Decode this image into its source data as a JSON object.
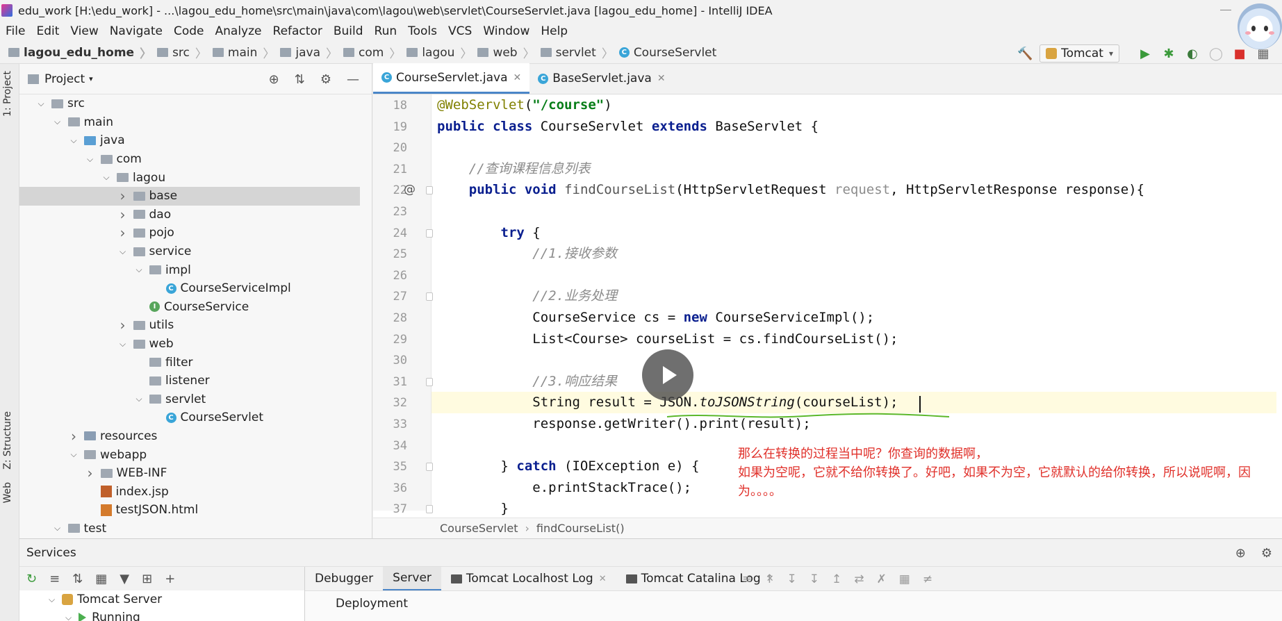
{
  "window": {
    "title": "edu_work [H:\\edu_work] - ...\\lagou_edu_home\\src\\main\\java\\com\\lagou\\web\\servlet\\CourseServlet.java [lagou_edu_home] - IntelliJ IDEA"
  },
  "menu": [
    "File",
    "Edit",
    "View",
    "Navigate",
    "Code",
    "Analyze",
    "Refactor",
    "Build",
    "Run",
    "Tools",
    "VCS",
    "Window",
    "Help"
  ],
  "breadcrumbs": [
    "lagou_edu_home",
    "src",
    "main",
    "java",
    "com",
    "lagou",
    "web",
    "servlet",
    "CourseServlet"
  ],
  "run_config": "Tomcat",
  "left_strip": {
    "project_tab": "1: Project",
    "structure_tab": "Z: Structure",
    "web_tab": "Web"
  },
  "project_panel": {
    "title": "Project",
    "tree": [
      {
        "label": "src",
        "depth": 0,
        "arrow": "v",
        "icon": "folder"
      },
      {
        "label": "main",
        "depth": 1,
        "arrow": "v",
        "icon": "folder"
      },
      {
        "label": "java",
        "depth": 2,
        "arrow": "v",
        "icon": "src-folder"
      },
      {
        "label": "com",
        "depth": 3,
        "arrow": "v",
        "icon": "folder"
      },
      {
        "label": "lagou",
        "depth": 4,
        "arrow": "v",
        "icon": "folder"
      },
      {
        "label": "base",
        "depth": 5,
        "arrow": ">",
        "icon": "folder",
        "selected": true
      },
      {
        "label": "dao",
        "depth": 5,
        "arrow": ">",
        "icon": "folder"
      },
      {
        "label": "pojo",
        "depth": 5,
        "arrow": ">",
        "icon": "folder"
      },
      {
        "label": "service",
        "depth": 5,
        "arrow": "v",
        "icon": "folder"
      },
      {
        "label": "impl",
        "depth": 6,
        "arrow": "v",
        "icon": "folder"
      },
      {
        "label": "CourseServiceImpl",
        "depth": 7,
        "arrow": "",
        "icon": "class"
      },
      {
        "label": "CourseService",
        "depth": 6,
        "arrow": "",
        "icon": "interface"
      },
      {
        "label": "utils",
        "depth": 5,
        "arrow": ">",
        "icon": "folder"
      },
      {
        "label": "web",
        "depth": 5,
        "arrow": "v",
        "icon": "folder"
      },
      {
        "label": "filter",
        "depth": 6,
        "arrow": "",
        "icon": "folder"
      },
      {
        "label": "listener",
        "depth": 6,
        "arrow": "",
        "icon": "folder"
      },
      {
        "label": "servlet",
        "depth": 6,
        "arrow": "v",
        "icon": "folder"
      },
      {
        "label": "CourseServlet",
        "depth": 7,
        "arrow": "",
        "icon": "class"
      },
      {
        "label": "resources",
        "depth": 2,
        "arrow": ">",
        "icon": "res-folder"
      },
      {
        "label": "webapp",
        "depth": 2,
        "arrow": "v",
        "icon": "folder"
      },
      {
        "label": "WEB-INF",
        "depth": 3,
        "arrow": ">",
        "icon": "folder"
      },
      {
        "label": "index.jsp",
        "depth": 3,
        "arrow": "",
        "icon": "jsp"
      },
      {
        "label": "testJSON.html",
        "depth": 3,
        "arrow": "",
        "icon": "html"
      },
      {
        "label": "test",
        "depth": 1,
        "arrow": "v",
        "icon": "folder"
      }
    ]
  },
  "editor": {
    "tabs": [
      {
        "label": "CourseServlet.java",
        "active": true
      },
      {
        "label": "BaseServlet.java",
        "active": false
      }
    ],
    "lines": [
      {
        "no": "18",
        "html": "<span class=\"ann\">@WebServlet</span>(<span class=\"str\">\"/course\"</span>)"
      },
      {
        "no": "19",
        "html": "<span class=\"kw\">public class</span> CourseServlet <span class=\"kw\">extends</span> BaseServlet {"
      },
      {
        "no": "20",
        "html": ""
      },
      {
        "no": "21",
        "html": "    <span class=\"cmt\">//查询课程信息列表</span>"
      },
      {
        "no": "22",
        "html": "    <span class=\"kw\">public void</span> <span class=\"fn\">findCourseList</span>(HttpServletRequest <span class=\"param\">request</span>, HttpServletResponse response){",
        "gutter": "@"
      },
      {
        "no": "23",
        "html": ""
      },
      {
        "no": "24",
        "html": "        <span class=\"kw\">try</span> {"
      },
      {
        "no": "25",
        "html": "            <span class=\"cmt\">//1.接收参数</span>"
      },
      {
        "no": "26",
        "html": ""
      },
      {
        "no": "27",
        "html": "            <span class=\"cmt\">//2.业务处理</span>"
      },
      {
        "no": "28",
        "html": "            CourseService cs = <span class=\"kw\">new</span> CourseServiceImpl();"
      },
      {
        "no": "29",
        "html": "            List&lt;Course&gt; courseList = cs.findCourseList();"
      },
      {
        "no": "30",
        "html": ""
      },
      {
        "no": "31",
        "html": "            <span class=\"cmt\">//3.响应结果</span>"
      },
      {
        "no": "32",
        "html": "            String result = JSON.<span class=\"itl\">toJSONString</span>(courseList);",
        "current": true
      },
      {
        "no": "33",
        "html": "            response.getWriter().print(result);"
      },
      {
        "no": "34",
        "html": ""
      },
      {
        "no": "35",
        "html": "        } <span class=\"kw\">catch</span> (IOException e) {"
      },
      {
        "no": "36",
        "html": "            e.printStackTrace();"
      },
      {
        "no": "37",
        "html": "        }"
      }
    ],
    "crumbs": [
      "CourseServlet",
      "findCourseList()"
    ]
  },
  "subtitle": {
    "line1": "那么在转换的过程当中呢？你查询的数据啊，",
    "line2": "如果为空呢，它就不给你转换了。好吧，如果不为空，它就默认的给你转换，所以说呢啊，因为。。。。"
  },
  "services": {
    "title": "Services",
    "tree": [
      {
        "label": "Tomcat Server",
        "arrow": "v"
      },
      {
        "label": "Running",
        "arrow": "v"
      }
    ],
    "tabs": [
      {
        "label": "Debugger",
        "active": false
      },
      {
        "label": "Server",
        "active": true
      },
      {
        "label": "Tomcat Localhost Log",
        "active": false,
        "closable": true
      },
      {
        "label": "Tomcat Catalina Log",
        "active": false,
        "closable": true
      }
    ],
    "deployment_label": "Deployment"
  }
}
